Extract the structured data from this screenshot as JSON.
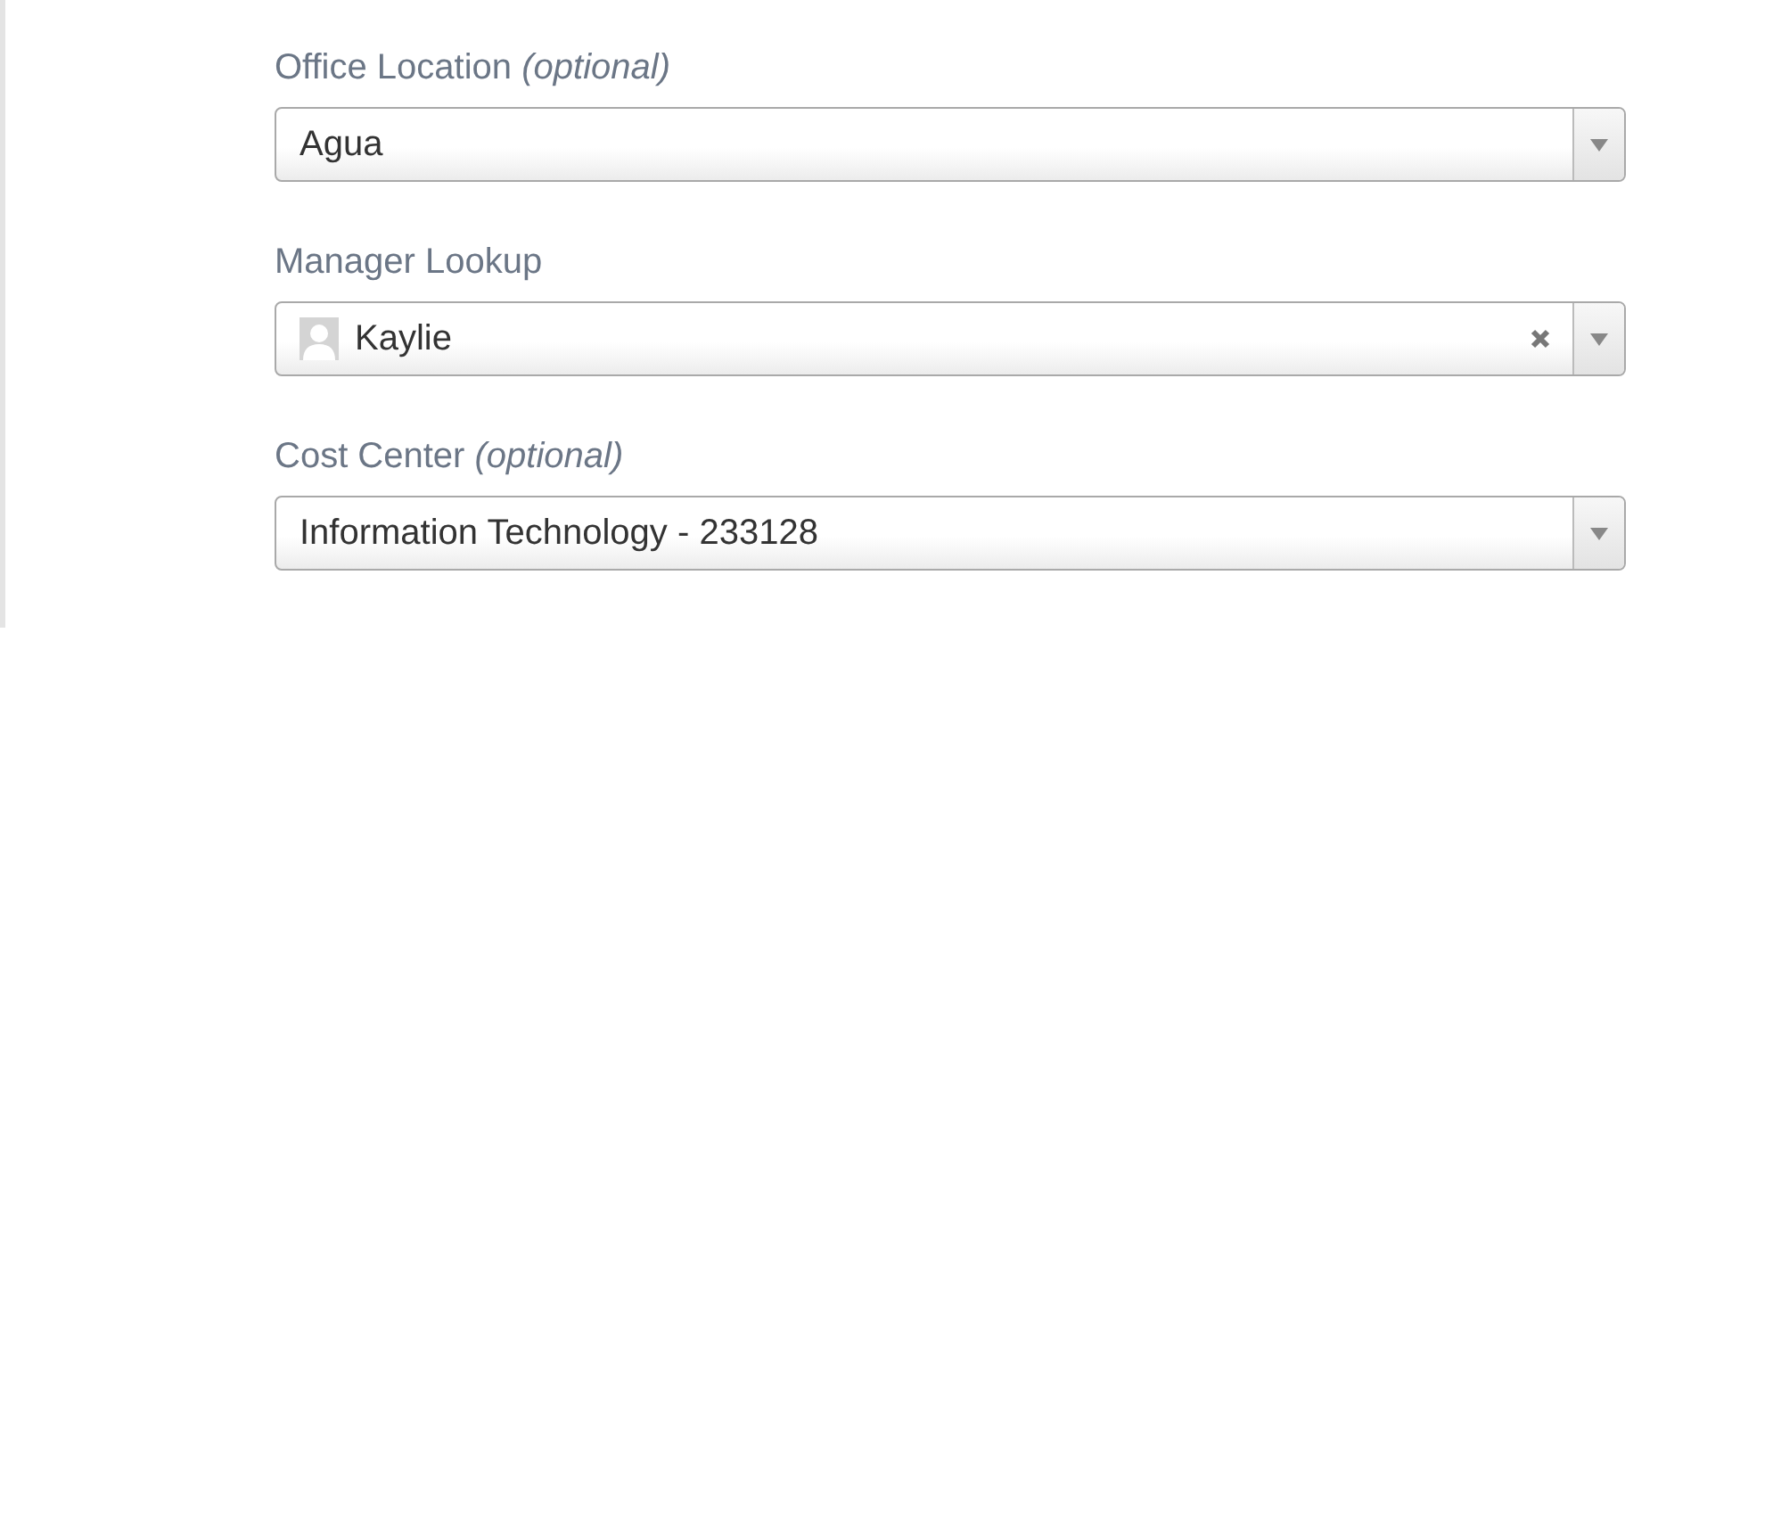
{
  "fields": [
    {
      "label": "Office Location *(optional)*",
      "kind": "select",
      "value": "Agua",
      "clearable": false
    },
    {
      "label": "Manager Lookup",
      "kind": "person",
      "value": "Kaylie",
      "clearable": true
    },
    {
      "label": "Cost Center *(optional)*",
      "kind": "select",
      "value": "Information Technology - 233128",
      "clearable": false
    }
  ]
}
